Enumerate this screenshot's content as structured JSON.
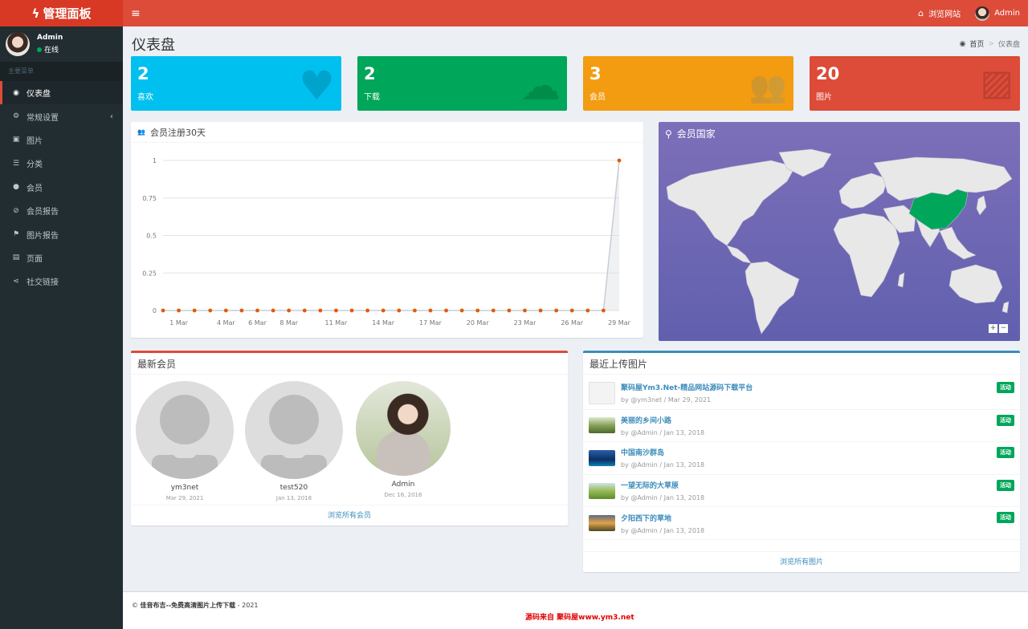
{
  "brand": {
    "logo_text": "管理面板"
  },
  "navbar": {
    "menu_toggle": "≡",
    "browse_site": "浏览网站",
    "user": "Admin"
  },
  "sidebar": {
    "user_name": "Admin",
    "user_status": "在线",
    "menu_header": "主要菜单",
    "items": [
      {
        "label": "仪表盘",
        "icon": "dashboard-icon",
        "glyph": "◉"
      },
      {
        "label": "常规设置",
        "icon": "cogs-icon",
        "glyph": "⚙"
      },
      {
        "label": "图片",
        "icon": "image-icon",
        "glyph": "▣"
      },
      {
        "label": "分类",
        "icon": "list-icon",
        "glyph": "☰"
      },
      {
        "label": "会员",
        "icon": "user-icon",
        "glyph": "●"
      },
      {
        "label": "会员报告",
        "icon": "ban-icon",
        "glyph": "⊘"
      },
      {
        "label": "图片报告",
        "icon": "flag-icon",
        "glyph": "⚑"
      },
      {
        "label": "页面",
        "icon": "file-icon",
        "glyph": "▤"
      },
      {
        "label": "社交链接",
        "icon": "share-icon",
        "glyph": "⋖"
      }
    ]
  },
  "page": {
    "title": "仪表盘",
    "breadcrumb_home": "首页",
    "breadcrumb_current": "仪表盘"
  },
  "stats": [
    {
      "value": "2",
      "label": "喜欢",
      "color": "#00c0ef",
      "icon": "heart-icon"
    },
    {
      "value": "2",
      "label": "下载",
      "color": "#00a65a",
      "icon": "cloud-download-icon"
    },
    {
      "value": "3",
      "label": "会员",
      "color": "#f39c12",
      "icon": "users-icon"
    },
    {
      "value": "20",
      "label": "图片",
      "color": "#dd4b39",
      "icon": "images-icon"
    }
  ],
  "chart_box": {
    "title": "会员注册30天"
  },
  "chart_data": {
    "type": "line",
    "title": "",
    "xlabel": "",
    "ylabel": "",
    "ylim": [
      0,
      1
    ],
    "y_ticks": [
      "0",
      "0.25",
      "0.5",
      "0.75",
      "1"
    ],
    "x_tick_labels": [
      "1 Mar",
      "4 Mar",
      "6 Mar",
      "8 Mar",
      "11 Mar",
      "14 Mar",
      "17 Mar",
      "20 Mar",
      "23 Mar",
      "26 Mar",
      "29 Mar"
    ],
    "x_tick_index": [
      1,
      4,
      6,
      8,
      11,
      14,
      17,
      20,
      23,
      26,
      29
    ],
    "x": [
      "28 Feb",
      "1 Mar",
      "2 Mar",
      "3 Mar",
      "4 Mar",
      "5 Mar",
      "6 Mar",
      "7 Mar",
      "8 Mar",
      "9 Mar",
      "10 Mar",
      "11 Mar",
      "12 Mar",
      "13 Mar",
      "14 Mar",
      "15 Mar",
      "16 Mar",
      "17 Mar",
      "18 Mar",
      "19 Mar",
      "20 Mar",
      "21 Mar",
      "22 Mar",
      "23 Mar",
      "24 Mar",
      "25 Mar",
      "26 Mar",
      "27 Mar",
      "28 Mar",
      "29 Mar"
    ],
    "values": [
      0,
      0,
      0,
      0,
      0,
      0,
      0,
      0,
      0,
      0,
      0,
      0,
      0,
      0,
      0,
      0,
      0,
      0,
      0,
      0,
      0,
      0,
      0,
      0,
      0,
      0,
      0,
      0,
      0,
      1
    ],
    "series_color": "#e25a0c",
    "grid": true
  },
  "map_box": {
    "title": "会员国家",
    "zoom_in": "+",
    "zoom_out": "−",
    "highlight_color": "#00a65a"
  },
  "members_box": {
    "title": "最新会员",
    "members": [
      {
        "name": "ym3net",
        "date": "Mar 29, 2021"
      },
      {
        "name": "test520",
        "date": "Jan 13, 2018"
      },
      {
        "name": "Admin",
        "date": "Dec 16, 2016"
      }
    ],
    "footer": "浏览所有会员"
  },
  "uploads_box": {
    "title": "最近上传图片",
    "items": [
      {
        "title": "聚码屋Ym3.Net-精品网站源码下载平台",
        "desc": "by @ym3net / Mar 29, 2021",
        "badge": "活动"
      },
      {
        "title": "美丽的乡间小路",
        "desc": "by @Admin / Jan 13, 2018",
        "badge": "活动"
      },
      {
        "title": "中国南沙群岛",
        "desc": "by @Admin / Jan 13, 2018",
        "badge": "活动"
      },
      {
        "title": "一望无际的大草原",
        "desc": "by @Admin / Jan 13, 2018",
        "badge": "活动"
      },
      {
        "title": "夕阳西下的草地",
        "desc": "by @Admin / Jan 13, 2018",
        "badge": "活动"
      }
    ],
    "footer": "浏览所有图片"
  },
  "footer": {
    "copy_prefix": "© ",
    "site": "佳音布吉--免费高清图片上传下载",
    "year": " - 2021",
    "watermark": "源码来自 聚码屋www.ym3.net"
  }
}
